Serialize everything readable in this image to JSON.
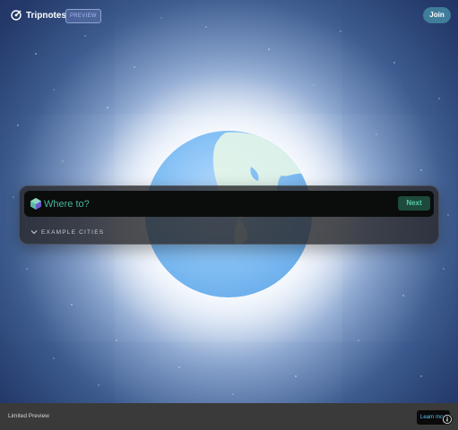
{
  "header": {
    "logo_text": "Tripnotes",
    "badge": "PREVIEW",
    "join_label": "Join"
  },
  "search": {
    "placeholder": "Where to?",
    "next_label": "Next",
    "examples_label": "EXAMPLE CITIES"
  },
  "footer": {
    "status_text": "Limited Preview",
    "learn_more_label": "Learn more"
  },
  "icons": {
    "logo": "compass-pin-icon",
    "search": "cube-gem-icon",
    "examples": "chevron-down-icon",
    "info": "info-icon"
  },
  "colors": {
    "accent_teal": "#4fbba0",
    "join_bg": "#3f7d9a",
    "next_bg": "#1d4a3c",
    "footer_bg": "#3a3a3a"
  }
}
